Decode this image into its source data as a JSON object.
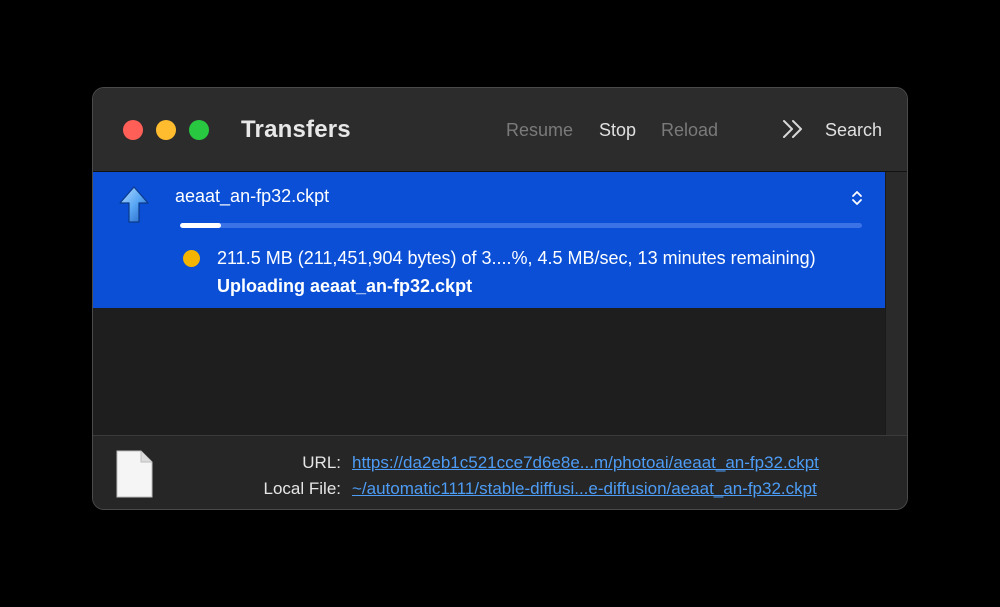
{
  "window": {
    "title": "Transfers"
  },
  "toolbar": {
    "resume_label": "Resume",
    "stop_label": "Stop",
    "reload_label": "Reload",
    "more_icon": "double-chevron-right-icon",
    "search_label": "Search"
  },
  "transfer": {
    "filename": "aeaat_an-fp32.ckpt",
    "direction_icon": "upload-arrow-icon",
    "progress_fraction": 0.06,
    "status_text": "211.5 MB (211,451,904 bytes) of 3....%, 4.5 MB/sec, 13 minutes remaining)",
    "status_detail": "Uploading aeaat_an-fp32.ckpt",
    "status_dot_color": "#f5b400",
    "row_color": "#0a4fd6"
  },
  "info": {
    "url_label": "URL:",
    "url_value": "https://da2eb1c521cce7d6e8e...m/photoai/aeaat_an-fp32.ckpt",
    "local_label": "Local File:",
    "local_value": "~/automatic1111/stable-diffusi...e-diffusion/aeaat_an-fp32.ckpt",
    "link_color": "#4d9cf5"
  },
  "colors": {
    "close": "#ff5f57",
    "minimize": "#febc2e",
    "maximize": "#28c840"
  }
}
